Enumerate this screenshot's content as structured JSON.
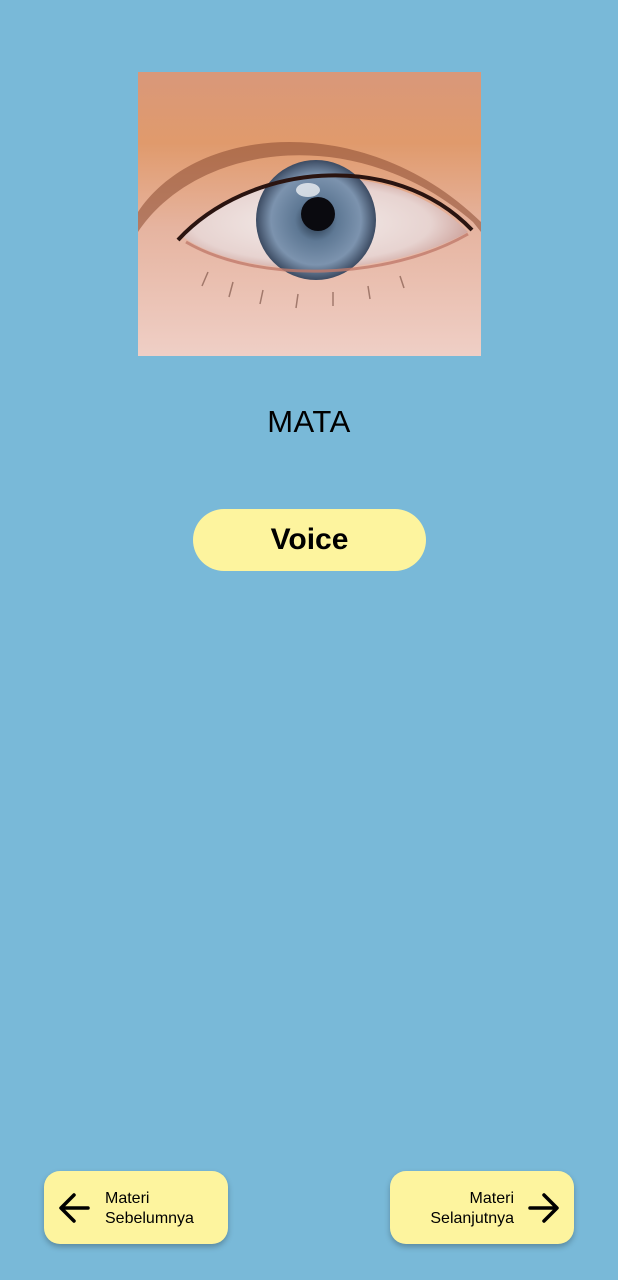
{
  "content": {
    "image_subject": "eye-photo",
    "title": "MATA"
  },
  "actions": {
    "voice_label": "Voice"
  },
  "navigation": {
    "prev": {
      "line1": "Materi",
      "line2": "Sebelumnya",
      "icon": "arrow-left-icon"
    },
    "next": {
      "line1": "Materi",
      "line2": "Selanjutnya",
      "icon": "arrow-right-icon"
    }
  },
  "colors": {
    "background": "#79B9D8",
    "button": "#FDF49E",
    "text": "#000000"
  }
}
